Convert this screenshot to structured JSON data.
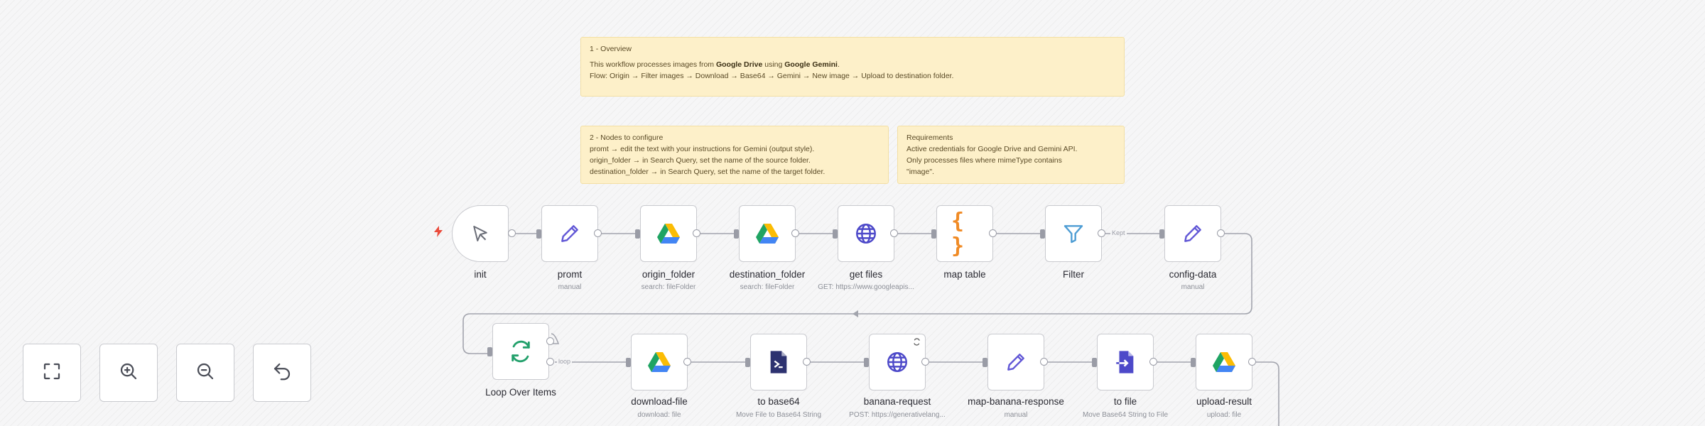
{
  "notes": {
    "overview": {
      "heading": "1 - Overview",
      "line1_pre": "This workflow processes images from ",
      "line1_b1": "Google Drive",
      "line1_mid": " using ",
      "line1_b2": "Google Gemini",
      "line1_end": ".",
      "line2": "Flow: Origin → Filter images → Download → Base64 → Gemini → New image → Upload to destination folder."
    },
    "configure": {
      "heading": "2 - Nodes to configure",
      "lines": [
        "promt → edit the text with your instructions for Gemini (output style).",
        "origin_folder → in Search Query, set the name of the source folder.",
        "destination_folder → in Search Query, set the name of the target folder."
      ]
    },
    "requirements": {
      "heading": "Requirements",
      "lines": [
        "Active credentials for Google Drive and Gemini API.",
        "Only processes files where mimeType contains",
        "\"image\"."
      ]
    }
  },
  "nodes": {
    "init": {
      "label": "init",
      "sub": "",
      "icon": "cursor-icon"
    },
    "promt": {
      "label": "promt",
      "sub": "manual",
      "icon": "pencil-icon"
    },
    "origin_folder": {
      "label": "origin_folder",
      "sub": "search: fileFolder",
      "icon": "google-drive-icon"
    },
    "destination_folder": {
      "label": "destination_folder",
      "sub": "search: fileFolder",
      "icon": "google-drive-icon"
    },
    "get_files": {
      "label": "get files",
      "sub": "GET: https://www.googleapis...",
      "icon": "globe-icon"
    },
    "map_table": {
      "label": "map table",
      "sub": "",
      "icon": "braces-icon"
    },
    "filter": {
      "label": "Filter",
      "sub": "",
      "icon": "filter-icon",
      "edge_label": "Kept"
    },
    "config_data": {
      "label": "config-data",
      "sub": "manual",
      "icon": "pencil-icon"
    },
    "loop": {
      "label": "Loop Over Items",
      "sub": "",
      "icon": "refresh-icon",
      "edge_label": "loop"
    },
    "download_file": {
      "label": "download-file",
      "sub": "download: file",
      "icon": "google-drive-icon"
    },
    "to_base64": {
      "label": "to base64",
      "sub": "Move File to Base64 String",
      "icon": "file-convert-icon"
    },
    "banana_request": {
      "label": "banana-request",
      "sub": "POST: https://generativelang...",
      "icon": "globe-icon"
    },
    "map_banana_response": {
      "label": "map-banana-response",
      "sub": "manual",
      "icon": "pencil-icon"
    },
    "to_file": {
      "label": "to file",
      "sub": "Move Base64 String to File",
      "icon": "file-import-icon"
    },
    "upload_result": {
      "label": "upload-result",
      "sub": "upload: file",
      "icon": "google-drive-icon"
    }
  },
  "controls": {
    "fit": "fit-view-icon",
    "zoom_in": "zoom-in-icon",
    "zoom_out": "zoom-out-icon",
    "reset": "reset-icon"
  },
  "colors": {
    "sticky_bg": "#fdf0c9",
    "pencil": "#6157d6",
    "globe": "#4d49c9",
    "braces": "#f08a24",
    "filter": "#4e9dd4",
    "loop": "#22a06b",
    "trigger_bolt": "#ea4b3c"
  }
}
